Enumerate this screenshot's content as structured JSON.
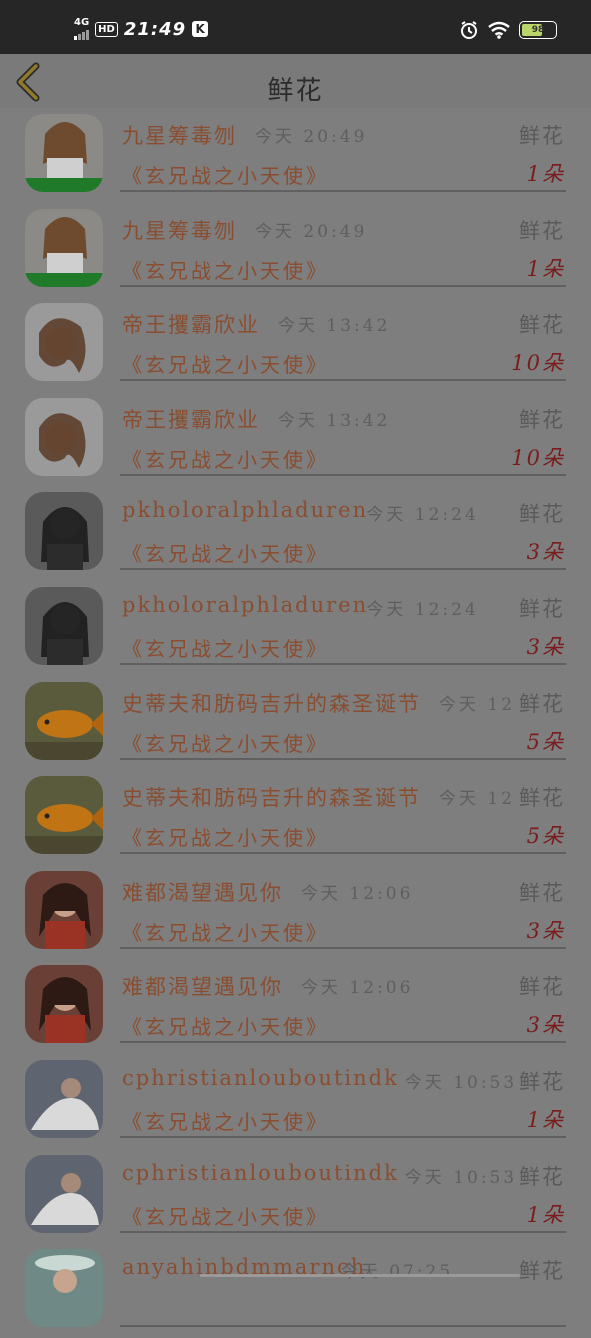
{
  "status_bar": {
    "network": "4G",
    "hd": "HD",
    "time": "21:49",
    "k_icon": "K",
    "battery": "98"
  },
  "header": {
    "title": "鲜花",
    "back_icon": "chevron-left-icon"
  },
  "gift_type_label": "鲜花",
  "gift_name": "《玄兄战之小天使》",
  "rows": [
    {
      "user": "九星筹毒刎",
      "time": "今天 20:49",
      "kind": "鲜花",
      "gift": "《玄兄战之小天使》",
      "count": "1朵",
      "avatar": "avatar-woman-green-banner"
    },
    {
      "user": "九星筹毒刎",
      "time": "今天 20:49",
      "kind": "鲜花",
      "gift": "《玄兄战之小天使》",
      "count": "1朵",
      "avatar": "avatar-woman-green-banner"
    },
    {
      "user": "帝王攫霸欣业",
      "time": "今天 13:42",
      "kind": "鲜花",
      "gift": "《玄兄战之小天使》",
      "count": "10朵",
      "avatar": "avatar-woman-curly"
    },
    {
      "user": "帝王攫霸欣业",
      "time": "今天 13:42",
      "kind": "鲜花",
      "gift": "《玄兄战之小天使》",
      "count": "10朵",
      "avatar": "avatar-woman-curly"
    },
    {
      "user": "pkholoralphladuren",
      "time": "今天 12:24",
      "kind": "鲜花",
      "gift": "《玄兄战之小天使》",
      "count": "3朵",
      "avatar": "avatar-bw-woman"
    },
    {
      "user": "pkholoralphladuren",
      "time": "今天 12:24",
      "kind": "鲜花",
      "gift": "《玄兄战之小天使》",
      "count": "3朵",
      "avatar": "avatar-bw-woman"
    },
    {
      "user": "史蒂夫和肪码吉升的森圣诞节",
      "time": "今天 12",
      "kind": "鲜花",
      "gift": "《玄兄战之小天使》",
      "count": "5朵",
      "avatar": "avatar-goldfish"
    },
    {
      "user": "史蒂夫和肪码吉升的森圣诞节",
      "time": "今天 12",
      "kind": "鲜花",
      "gift": "《玄兄战之小天使》",
      "count": "5朵",
      "avatar": "avatar-goldfish"
    },
    {
      "user": "难都渴望遇见你",
      "time": "今天 12:06",
      "kind": "鲜花",
      "gift": "《玄兄战之小天使》",
      "count": "3朵",
      "avatar": "avatar-woman-red"
    },
    {
      "user": "难都渴望遇见你",
      "time": "今天 12:06",
      "kind": "鲜花",
      "gift": "《玄兄战之小天使》",
      "count": "3朵",
      "avatar": "avatar-woman-red"
    },
    {
      "user": "cphristianlouboutindk",
      "time": "今天 10:53",
      "kind": "鲜花",
      "gift": "《玄兄战之小天使》",
      "count": "1朵",
      "avatar": "avatar-woman-white-dress"
    },
    {
      "user": "cphristianlouboutindk",
      "time": "今天 10:53",
      "kind": "鲜花",
      "gift": "《玄兄战之小天使》",
      "count": "1朵",
      "avatar": "avatar-woman-white-dress"
    },
    {
      "user": "anyahinbdmmarnch",
      "time": "今天 07:25",
      "kind": "鲜花",
      "gift": "",
      "count": "",
      "avatar": "avatar-woman-hat"
    }
  ],
  "colors": {
    "overlay": "#7e7e7e",
    "username": "#8a4d30",
    "count": "#7a1c1c",
    "back_arrow": "#c9a21a"
  }
}
